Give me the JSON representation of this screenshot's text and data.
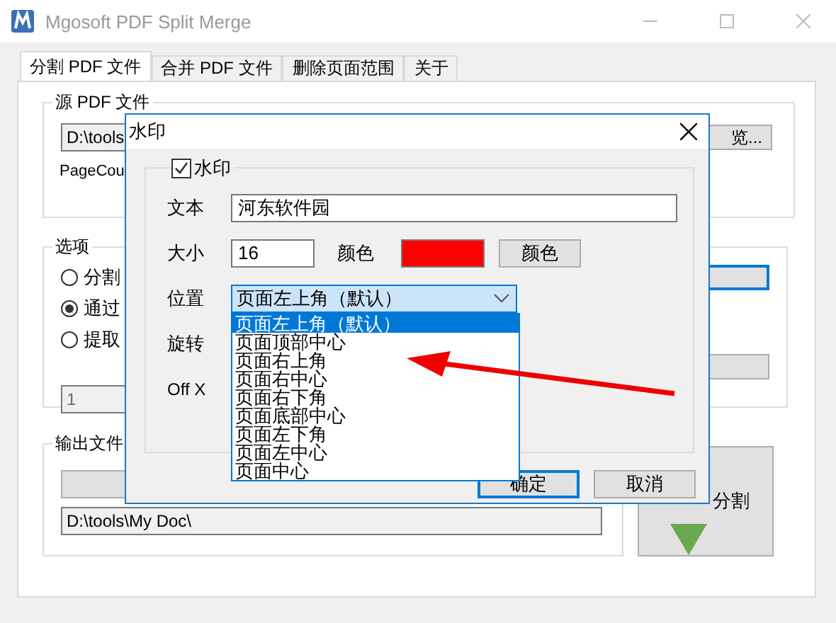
{
  "window": {
    "title": "Mgosoft PDF Split Merge"
  },
  "tabs": [
    {
      "label": "分割 PDF 文件",
      "selected": true
    },
    {
      "label": "合并 PDF 文件",
      "selected": false
    },
    {
      "label": "删除页面范围",
      "selected": false
    },
    {
      "label": "关于",
      "selected": false
    }
  ],
  "source_group": {
    "title": "源 PDF 文件",
    "path": "D:\\tools",
    "browse_button": "览...",
    "page_count_label": "PageCou"
  },
  "options_group": {
    "title": "选项",
    "radios": [
      {
        "label": "分割",
        "selected": false
      },
      {
        "label": "通过",
        "selected": true
      },
      {
        "label": "提取",
        "selected": false
      }
    ],
    "page_field": "1"
  },
  "output_group": {
    "title": "输出文件",
    "path": "D:\\tools\\My Doc\\"
  },
  "split_button": "分割",
  "dialog": {
    "title": "水印",
    "enable": {
      "label": "水印",
      "checked": true
    },
    "text_label": "文本",
    "text_value": "河东软件园",
    "size_label": "大小",
    "size_value": "16",
    "color_label": "颜色",
    "color": "#ff0000",
    "color_button": "颜色",
    "position_label": "位置",
    "position_value": "页面左上角（默认）",
    "position_options": [
      {
        "label": "页面左上角（默认）",
        "selected": true
      },
      {
        "label": "页面顶部中心",
        "selected": false
      },
      {
        "label": "页面右上角",
        "selected": false
      },
      {
        "label": "页面右中心",
        "selected": false
      },
      {
        "label": "页面右下角",
        "selected": false
      },
      {
        "label": "页面底部中心",
        "selected": false
      },
      {
        "label": "页面左下角",
        "selected": false
      },
      {
        "label": "页面左中心",
        "selected": false
      },
      {
        "label": "页面中心",
        "selected": false
      }
    ],
    "rotate_label": "旋转",
    "offx_label": "Off X",
    "ok_button": "确定",
    "cancel_button": "取消"
  }
}
